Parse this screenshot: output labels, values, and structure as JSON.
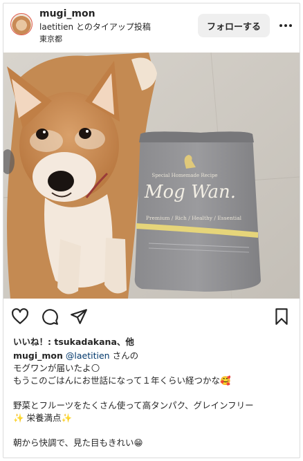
{
  "header": {
    "username": "mugi_mon",
    "sponsor_text": "laetitien とのタイアップ投稿",
    "location": "東京都",
    "follow_label": "フォローする",
    "more_icon": "more-horizontal-icon"
  },
  "photo": {
    "package": {
      "tagline": "Special Homemade Recipe",
      "brand": "Mog Wan.",
      "features": "Premium / Rich / Healthy / Essential"
    }
  },
  "actions": {
    "icons": [
      "heart-icon",
      "comment-icon",
      "share-icon",
      "bookmark-icon"
    ]
  },
  "likes_text": "いいね！: tsukadakana、他",
  "caption": {
    "username": "mugi_mon",
    "mention": "@laetitien",
    "mention_suffix": " さんの",
    "lines": [
      "モグワンが届いたよ🌕",
      "もうこのごはんにお世話になって１年くらい経つかな🥰",
      "野菜とフルーツをたくさん使って高タンパク、グレインフリー",
      "✨ 栄養満点✨",
      "朝から快調で、見た目もきれい😁"
    ]
  },
  "colors": {
    "text": "#262626",
    "mention": "#00376b",
    "follow_bg": "#efefef",
    "border": "#dbdbdb"
  }
}
